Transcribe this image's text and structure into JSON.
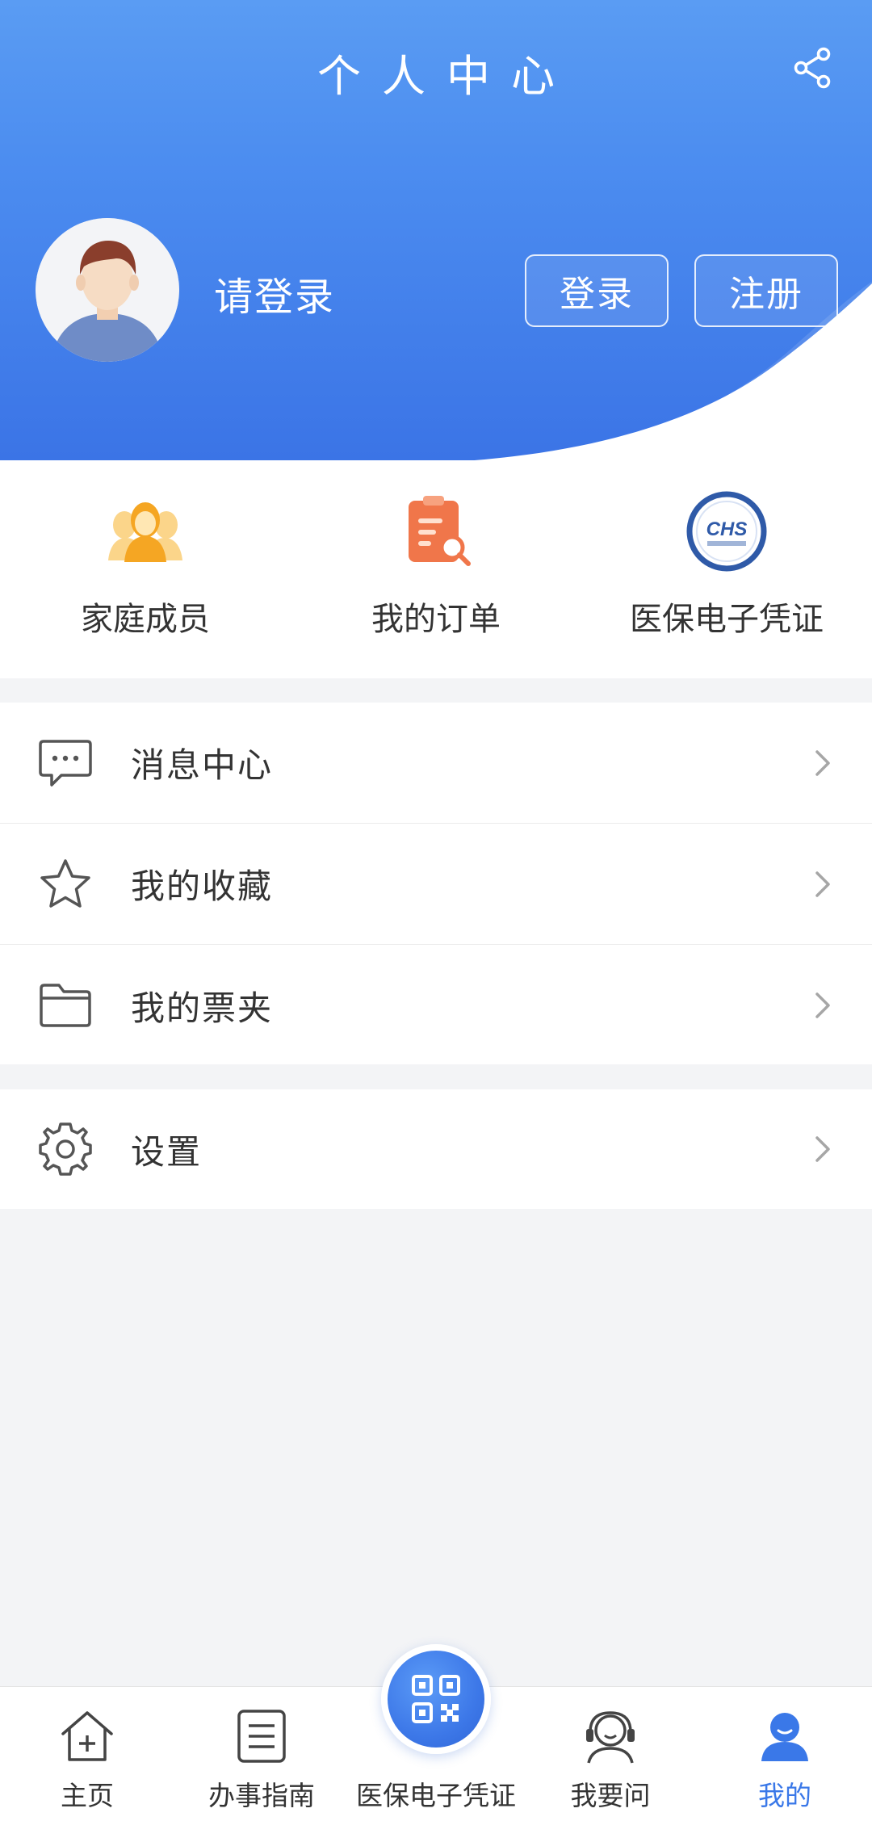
{
  "header": {
    "title": "个人中心",
    "login_prompt": "请登录",
    "login_button": "登录",
    "register_button": "注册"
  },
  "quick_actions": [
    {
      "label": "家庭成员",
      "icon": "family-members-icon"
    },
    {
      "label": "我的订单",
      "icon": "order-icon"
    },
    {
      "label": "医保电子凭证",
      "icon": "chs-logo-icon"
    }
  ],
  "menu": {
    "group1": [
      {
        "label": "消息中心",
        "icon": "message-icon"
      },
      {
        "label": "我的收藏",
        "icon": "star-icon"
      },
      {
        "label": "我的票夹",
        "icon": "folder-icon"
      }
    ],
    "group2": [
      {
        "label": "设置",
        "icon": "gear-icon"
      }
    ]
  },
  "bottom_nav": [
    {
      "label": "主页",
      "icon": "home-icon",
      "active": false
    },
    {
      "label": "办事指南",
      "icon": "guide-icon",
      "active": false
    },
    {
      "label": "医保电子凭证",
      "icon": "qr-code-icon",
      "active": false
    },
    {
      "label": "我要问",
      "icon": "support-icon",
      "active": false
    },
    {
      "label": "我的",
      "icon": "profile-icon",
      "active": true
    }
  ],
  "colors": {
    "accent": "#3a78e8",
    "header_top": "#5a9cf3",
    "header_bottom": "#3b74e6",
    "family_icon": "#f5a623",
    "order_icon": "#f0764a"
  }
}
